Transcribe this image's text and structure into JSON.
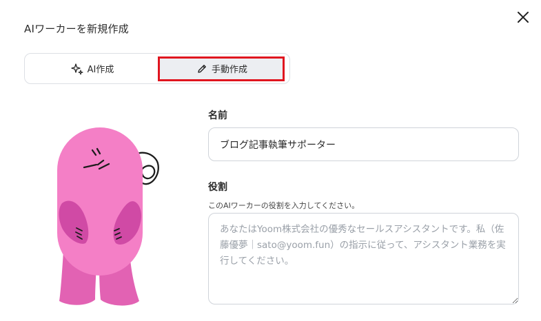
{
  "dialog": {
    "title": "AIワーカーを新規作成",
    "close_icon": "close-icon"
  },
  "mode_toggle": {
    "ai_label": "AI作成",
    "ai_icon": "sparkles-icon",
    "manual_label": "手動作成",
    "manual_icon": "pencil-icon",
    "selected": "manual"
  },
  "form": {
    "name_label": "名前",
    "name_value": "ブログ記事執筆サポーター",
    "role_label": "役割",
    "role_hint": "このAIワーカーの役割を入力してください。",
    "role_placeholder": "あなたはYoom株式会社の優秀なセールスアシスタントです。私（佐藤優夢｜sato@yoom.fun）の指示に従って、アシスタント業務を実行してください。"
  },
  "colors": {
    "highlight": "#e0151f",
    "mascot_body": "#f47fc6",
    "mascot_arms": "#d04aa5",
    "mascot_legs": "#e262b3"
  }
}
